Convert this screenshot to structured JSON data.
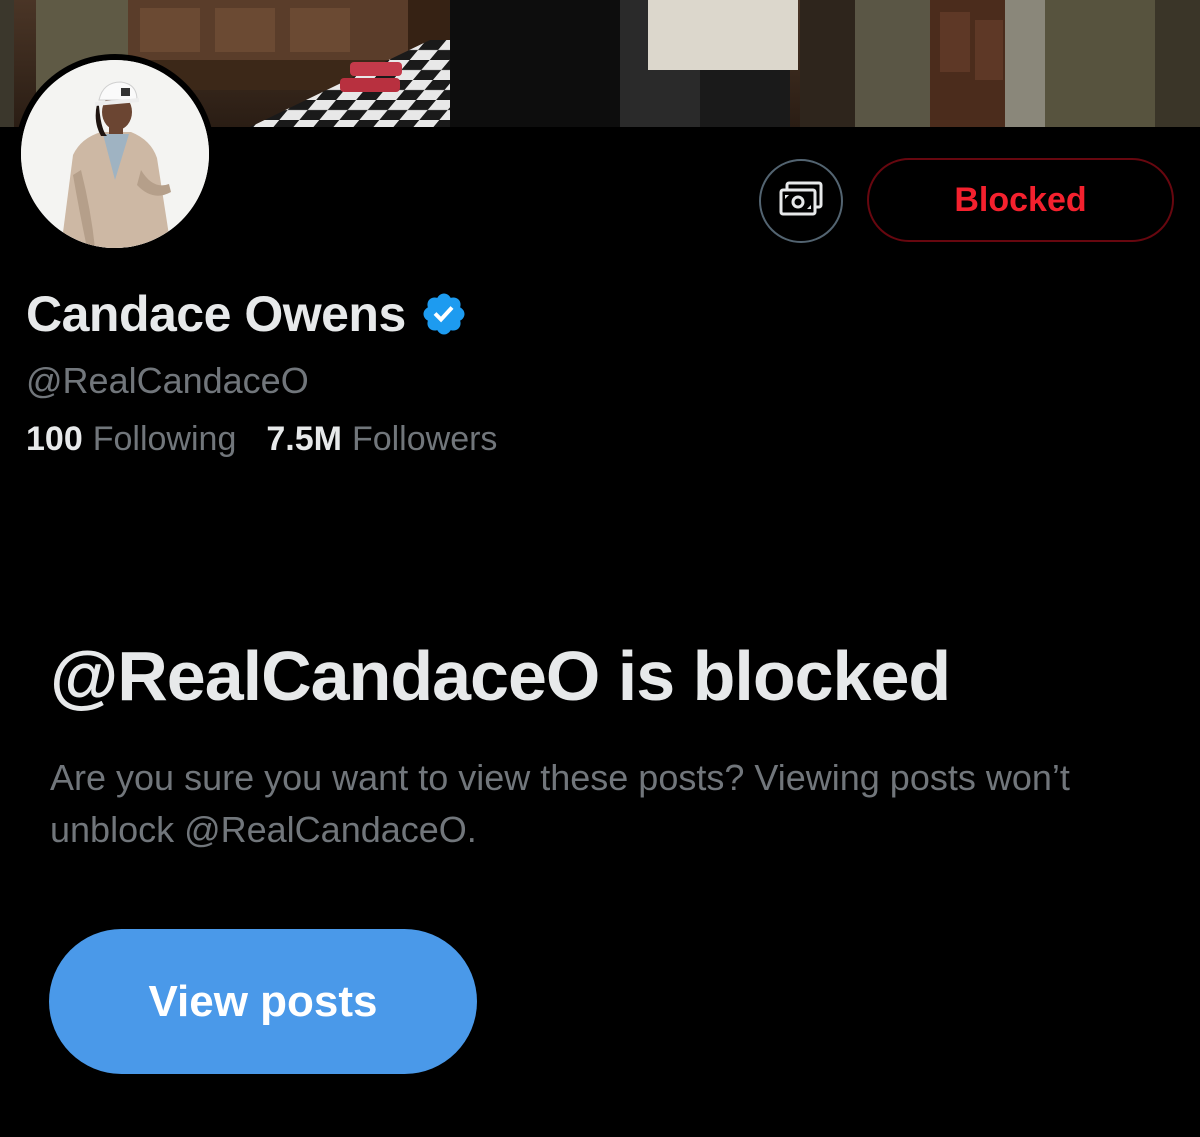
{
  "profile": {
    "display_name": "Candace Owens",
    "handle": "@RealCandaceO",
    "verified": true,
    "following_count": "100",
    "following_label": "Following",
    "followers_count": "7.5M",
    "followers_label": "Followers"
  },
  "actions": {
    "tip_icon": "money-icon",
    "blocked_label": "Blocked"
  },
  "blocked_notice": {
    "title": "@RealCandaceO is blocked",
    "description": "Are you sure you want to view these posts? Viewing posts won’t unblock @RealCandaceO.",
    "view_posts_label": "View posts"
  },
  "colors": {
    "background": "#000000",
    "primary_text": "#e7e9ea",
    "secondary_text": "#71767b",
    "blocked_red": "#f4212e",
    "accent_blue": "#4a99e9",
    "verified_blue": "#1d9bf0"
  }
}
